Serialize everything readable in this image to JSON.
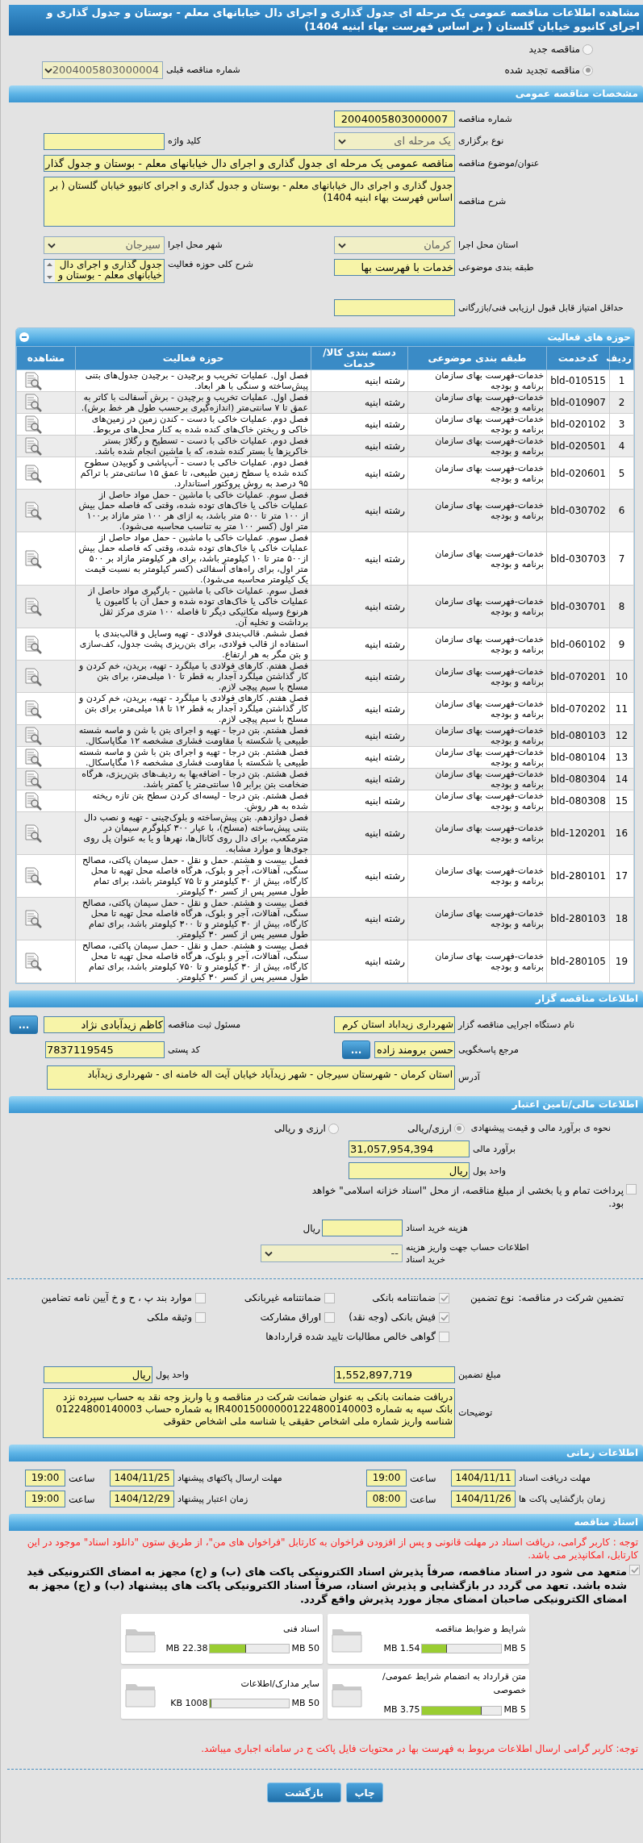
{
  "title": "مشاهده اطلاعات مناقصه عمومی یک مرحله ای جدول گذاری و اجرای دال خیابانهای معلم - بوستان و جدول گذاری و اجرای کانیوو خیابان گلستان ( بر اساس فهرست بهاء ابنیه 1404)",
  "tender_type": [
    {
      "label": "مناقصه جدید",
      "selected": false
    },
    {
      "label": "مناقصه تجدید شده",
      "selected": true
    }
  ],
  "previous_tender": {
    "label": "شماره مناقصه قبلی",
    "value": "2004005803000004"
  },
  "general": {
    "title": "مشخصات مناقصه عمومی",
    "tender_number": {
      "label": "شماره مناقصه",
      "value": "2004005803000007"
    },
    "holding_type": {
      "label": "نوع برگزاری",
      "value": "یک مرحله ای"
    },
    "keyword": {
      "label": "کلید واژه"
    },
    "subject": {
      "label": "عنوان/موضوع مناقصه",
      "value": "مناقصه عمومی یک مرحله ای جدول گذاری و اجرای دال خیابانهای معلم - بوستان و جدول گذار"
    },
    "description": {
      "label": "شرح مناقصه",
      "value": "جدول گذاری و اجرای دال خیابانهای معلم - بوستان و جدول گذاری و اجرای کانیوو خیابان گلستان ( بر اساس فهرست بهاء ابنیه 1404)"
    },
    "province": {
      "label": "استان محل اجرا",
      "value": "کرمان"
    },
    "city": {
      "label": "شهر محل اجرا",
      "value": "سیرجان"
    },
    "category": {
      "label": "طبقه بندی موضوعی",
      "value": "خدمات با فهرست بها"
    },
    "activity_scope": {
      "label": "شرح کلی حوزه فعالیت",
      "value": "جدول گذاری و اجرای دال خیابانهای معلم - بوستان و"
    },
    "min_score": {
      "label": "حداقل امتیاز قابل قبول ارزیابی فنی/بازرگانی"
    }
  },
  "activities": {
    "title": "حوزه های فعالیت",
    "columns": [
      "ردیف",
      "کدخدمت",
      "طبقه بندی موضوعی",
      "دسته بندی کالا/خدمات",
      "حوزه فعالیت",
      "مشاهده"
    ],
    "rows": [
      {
        "row": "1",
        "code": "bld-010515",
        "classification": "خدمات-فهرست بهای سازمان برنامه و بودجه",
        "category": "رشته ابنیه",
        "activity": "فصل اول. عملیات تخریب و برچیدن - برچیدن جدول‌های بتنی پیش‌ساخته و سنگی با هر ابعاد."
      },
      {
        "row": "2",
        "code": "bld-010907",
        "classification": "خدمات-فهرست بهای سازمان برنامه و بودجه",
        "category": "رشته ابنیه",
        "activity": "فصل اول. عملیات تخریب و برچیدن - برش آسفالت با کاتر به عمق تا ۷ سانتی‌متر (اندازه‌گیری برحسب طول هر خط برش)."
      },
      {
        "row": "3",
        "code": "bld-020102",
        "classification": "خدمات-فهرست بهای سازمان برنامه و بودجه",
        "category": "رشته ابنیه",
        "activity": "فصل دوم. عملیات خاکی با دست - کندن زمین در زمین‌های خاکی و ریختن خاک‌های کنده شده به کنار محل‌های مربوط."
      },
      {
        "row": "4",
        "code": "bld-020501",
        "classification": "خدمات-فهرست بهای سازمان برنامه و بودجه",
        "category": "رشته ابنیه",
        "activity": "فصل دوم. عملیات خاکی با دست - تسطیح و رگلاژ بستر خاکریزها یا بستر کنده شده، که با ماشین انجام شده باشد."
      },
      {
        "row": "5",
        "code": "bld-020601",
        "classification": "خدمات-فهرست بهای سازمان برنامه و بودجه",
        "category": "رشته ابنیه",
        "activity": "فصل دوم. عملیات خاکی با دست - آب‌پاشی و کوبیدن سطوح کنده شده یا سطح زمین طبیعی، تا عمق ۱۵ سانتی‌متر با تراکم ۹۵ درصد به روش پروکتور استاندارد."
      },
      {
        "row": "6",
        "code": "bld-030702",
        "classification": "خدمات-فهرست بهای سازمان برنامه و بودجه",
        "category": "رشته ابنیه",
        "activity": "فصل سوم. عملیات خاکی با ماشین - حمل مواد حاصل از عملیات خاکی یا خاک‌های توده شده، وقتی که فاصله حمل بیش از ۱۰۰ متر تا ۵۰۰ متر باشد، به ازای هر ۱۰۰ متر مازاد بر۱۰۰ متر اول (کسر ۱۰۰ متر به تناسب محاسبه می‌شود)."
      },
      {
        "row": "7",
        "code": "bld-030703",
        "classification": "خدمات-فهرست بهای سازمان برنامه و بودجه",
        "category": "رشته ابنیه",
        "activity": "فصل سوم. عملیات خاکی با ماشین - حمل مواد حاصل از عملیات خاکی یا خاک‌های توده شده، وقتی که فاصله حمل بیش از۵۰۰ متر تا ۱۰ کیلومتر باشد، برای هر کیلومتر مازاد بر ۵۰۰ متر اول، برای راه‌های آسفالتی (کسر کیلومتر به نسبت قیمت یک کیلومتر محاسبه می‌شود)."
      },
      {
        "row": "8",
        "code": "bld-030701",
        "classification": "خدمات-فهرست بهای سازمان برنامه و بودجه",
        "category": "رشته ابنیه",
        "activity": "فصل سوم. عملیات خاکی با ماشین - بارگیری مواد حاصل از عملیات خاکی یا خاک‌های توده شده و حمل آن با کامیون یا هرنوع وسیله مکانیکی دیگر تا فاصله ۱۰۰ متری مرکز ثقل برداشت و تخلیه آن."
      },
      {
        "row": "9",
        "code": "bld-060102",
        "classification": "خدمات-فهرست بهای سازمان برنامه و بودجه",
        "category": "رشته ابنیه",
        "activity": "فصل ششم. قالب‌بندی فولادی - تهیه وسایل و قالب‌بندی با استفاده از قالب فولادی، برای بتن‌ریزی پشت جدول، کف‌سازی و بتن مگر به هر ارتفاع."
      },
      {
        "row": "10",
        "code": "bld-070201",
        "classification": "خدمات-فهرست بهای سازمان برنامه و بودجه",
        "category": "رشته ابنیه",
        "activity": "فصل هفتم. کارهای فولادی با میلگرد - تهیه، بریدن، خم کردن و کار گذاشتن میلگرد آجدار به قطر تا ۱۰ میلی‌متر، برای بتن مسلح با سیم پیچی لازم."
      },
      {
        "row": "11",
        "code": "bld-070202",
        "classification": "خدمات-فهرست بهای سازمان برنامه و بودجه",
        "category": "رشته ابنیه",
        "activity": "فصل هفتم. کارهای فولادی با میلگرد - تهیه، بریدن، خم کردن و کار گذاشتن میلگرد آجدار به قطر ۱۲ تا ۱۸ میلی‌متر، برای بتن مسلح با سیم پیچی لازم."
      },
      {
        "row": "12",
        "code": "bld-080103",
        "classification": "خدمات-فهرست بهای سازمان برنامه و بودجه",
        "category": "رشته ابنیه",
        "activity": "فصل هشتم. بتن درجا - تهیه و اجرای بتن با شن و ماسه شسته طبیعی یا شکسته با مقاومت فشاری مشخصه ۱۲ مگاپاسکال."
      },
      {
        "row": "13",
        "code": "bld-080104",
        "classification": "خدمات-فهرست بهای سازمان برنامه و بودجه",
        "category": "رشته ابنیه",
        "activity": "فصل هشتم. بتن درجا - تهیه و اجرای بتن با شن و ماسه شسته طبیعی یا شکسته با مقاومت فشاری مشخصه ۱۶ مگاپاسکال."
      },
      {
        "row": "14",
        "code": "bld-080304",
        "classification": "خدمات-فهرست بهای سازمان برنامه و بودجه",
        "category": "رشته ابنیه",
        "activity": "فصل هشتم. بتن درجا - اضافه‌بها به ردیف‌های بتن‌ریزی، هرگاه ضخامت بتن برابر ۱۵ سانتی‌متر یا کمتر باشد."
      },
      {
        "row": "15",
        "code": "bld-080308",
        "classification": "خدمات-فهرست بهای سازمان برنامه و بودجه",
        "category": "رشته ابنیه",
        "activity": "فصل هشتم. بتن درجا - لیسه‌ای کردن سطح بتن تازه ریخته شده به هر روش."
      },
      {
        "row": "16",
        "code": "bld-120201",
        "classification": "خدمات-فهرست بهای سازمان برنامه و بودجه",
        "category": "رشته ابنیه",
        "activity": "فصل دوازدهم. بتن پیش‌ساخته و بلوک‌چینی - تهیه و نصب دال بتنی پیش‌ساخته (مسلح)، با عیار ۳۰۰ کیلوگرم سیمان در مترمکعب، برای دال روی کانال‌ها، نهرها و یا به عنوان پل روی جوی‌ها و موارد مشابه."
      },
      {
        "row": "17",
        "code": "bld-280101",
        "classification": "خدمات-فهرست بهای سازمان برنامه و بودجه",
        "category": "رشته ابنیه",
        "activity": "فصل بیست و هشتم. حمل و نقل - حمل سیمان پاکتی، مصالح سنگی، آهنالات، آجر و بلوک، هرگاه فاصله محل تهیه تا محل کارگاه، بیش از ۳۰ کیلومتر و تا ۷۵ کیلومتر باشد، برای تمام طول مسیر پس از کسر ۳۰ کیلومتر."
      },
      {
        "row": "18",
        "code": "bld-280103",
        "classification": "خدمات-فهرست بهای سازمان برنامه و بودجه",
        "category": "رشته ابنیه",
        "activity": "فصل بیست و هشتم. حمل و نقل - حمل سیمان پاکتی، مصالح سنگی، آهنالات، آجر و بلوک، هرگاه فاصله محل تهیه تا محل کارگاه، بیش از ۳۰ کیلومتر و تا ۳۰۰ کیلومتر باشد، برای تمام طول مسیر پس از کسر ۳۰ کیلومتر."
      },
      {
        "row": "19",
        "code": "bld-280105",
        "classification": "خدمات-فهرست بهای سازمان برنامه و بودجه",
        "category": "رشته ابنیه",
        "activity": "فصل بیست و هشتم. حمل و نقل - حمل سیمان پاکتی، مصالح سنگی، آهنالات، آجر و بلوک، هرگاه فاصله محل تهیه تا محل کارگاه، بیش از ۳۰ کیلومتر و تا ۷۵۰ کیلومتر باشد، برای تمام طول مسیر پس از کسر ۳۰ کیلومتر."
      }
    ]
  },
  "tenderer": {
    "title": "اطلاعات مناقصه گزار",
    "organization": {
      "label": "نام دستگاه اجرایی مناقصه گزار",
      "value": "شهرداری زیداباد استان کرم"
    },
    "registrar": {
      "label": "مسئول ثبت مناقصه",
      "value": "کاظم زیدآبادی نژاد",
      "button": "..."
    },
    "responder": {
      "label": "مرجع پاسخگویی",
      "value": "حسن برومند زاده",
      "button": "..."
    },
    "postal_code": {
      "label": "کد پستی",
      "value": "7837119545"
    },
    "address": {
      "label": "آدرس",
      "value": "استان کرمان - شهرستان سیرجان - شهر زیدآباد خیابان آیت اله خامنه ای -  شهرداری زیدآباد"
    }
  },
  "financial": {
    "title": "اطلاعات مالی/تامین اعتبار",
    "pricing": {
      "label": "نحوه ی برآورد مالی و قیمت پیشنهادی",
      "options": [
        {
          "label": "ارزی/ریالی",
          "selected": true
        },
        {
          "label": "ارزی و ریالی",
          "selected": false
        }
      ]
    },
    "estimate": {
      "label": "برآورد مالی",
      "value": "31,057,954,394"
    },
    "currency": {
      "label": "واحد پول",
      "value": "ریال"
    },
    "treasury": {
      "label": "پرداخت تمام و یا بخشی از مبلغ مناقصه، از محل \"اسناد خزانه اسلامی\" خواهد بود.",
      "checked": false
    },
    "document_cost": {
      "label": "هزینه خرید اسناد",
      "unit": "ریال"
    },
    "account": {
      "label": "اطلاعات حساب جهت واریز هزینه خرید اسناد",
      "value": "--"
    },
    "guarantee": {
      "label": "تضمین شرکت در مناقصه:",
      "type_label": "نوع تضمین",
      "options": [
        {
          "label": "ضمانتنامه بانکی",
          "checked": true
        },
        {
          "label": "ضمانتنامه غیربانکی",
          "checked": false
        },
        {
          "label": "موارد بند پ ، ح و خ آیین نامه تضامین",
          "checked": false
        },
        {
          "label": "فیش بانکی (وجه نقد)",
          "checked": true
        },
        {
          "label": "اوراق مشارکت",
          "checked": false
        },
        {
          "label": "وثیقه ملکی",
          "checked": false
        },
        {
          "label": "گواهی خالص مطالبات تایید شده قراردادها",
          "checked": false
        }
      ]
    },
    "guarantee_amount": {
      "label": "مبلغ تضمین",
      "value": "1,552,897,719"
    },
    "guarantee_currency": {
      "label": "واحد پول",
      "value": "ریال"
    },
    "notes": {
      "label": "توضیحات",
      "value": "دریافت ضمانت بانکی به عنوان ضمانت شرکت در مناقصه و یا واریز وجه نقد به حساب سپرده نزد بانک سپه به شماره IR400150000001224800140003 به شماره حساب 01224800140003 شناسه واریز شماره ملی اشخاص حقیقی یا شناسه ملی اشخاص حقوقی"
    }
  },
  "timing": {
    "title": "اطلاعات زمانی",
    "items": [
      {
        "label": "مهلت دریافت اسناد",
        "date": "1404/11/11",
        "time_label": "ساعت",
        "time": "19:00"
      },
      {
        "label": "مهلت ارسال پاکتهای پیشنهاد",
        "date": "1404/11/25",
        "time_label": "ساعت",
        "time": "19:00"
      },
      {
        "label": "زمان بازگشایی پاکت ها",
        "date": "1404/11/26",
        "time_label": "ساعت",
        "time": "08:00"
      },
      {
        "label": "زمان اعتبار پیشنهاد",
        "date": "1404/12/29",
        "time_label": "ساعت",
        "time": "19:00"
      }
    ]
  },
  "documents": {
    "title": "اسناد مناقصه",
    "notice": "توجه : کاربر گرامی، دریافت اسناد در مهلت قانونی و پس از افزودن فراخوان به کارتابل \"فراخوان های من\"، از طریق ستون \"دانلود اسناد\" موجود در این کارتابل، امکانپذیر می باشد.",
    "commitment": {
      "checked": true,
      "text": "متعهد می شود در اسناد مناقصه، صرفاً پذیرش اسناد الکترونیکی پاکت های (ب) و (ج) مجهز به امضای الکترونیکی قید شده باشد. تعهد می گردد در بازگشایی و پذیرش اسناد، صرفاً اسناد الکترونیکی پاکت های پیشنهاد (ب) و (ج) مجهز به امضای الکترونیکی صاحبان امضای مجاز مورد پذیرش واقع گردد."
    },
    "files": [
      {
        "name": "شرایط و ضوابط مناقصه",
        "limit": "5 MB",
        "size": "1.54 MB",
        "level": 0.31
      },
      {
        "name": "اسناد فنی",
        "limit": "50 MB",
        "size": "22.38 MB",
        "level": 0.45
      },
      {
        "name": "متن قرارداد به انضمام شرایط عمومی/خصوصی",
        "limit": "5 MB",
        "size": "3.75 MB",
        "level": 0.75
      },
      {
        "name": "سایر مدارک/اطلاعات",
        "limit": "50 MB",
        "size": "1008 KB",
        "level": 0.02
      }
    ],
    "footer_note": "توجه: کاربر گرامی ارسال اطلاعات مربوط به فهرست بها در محتویات فایل پاکت ج در سامانه اجباری میباشد."
  },
  "buttons": [
    "چاپ",
    "بازگشت"
  ]
}
